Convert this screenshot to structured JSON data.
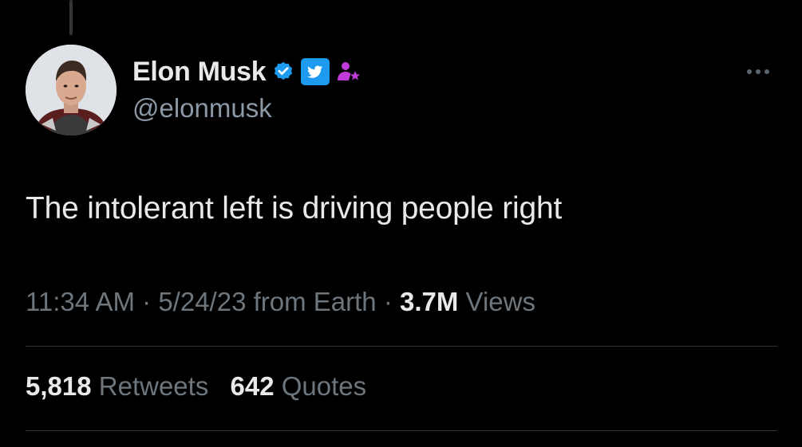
{
  "author": {
    "display_name": "Elon Musk",
    "handle": "@elonmusk",
    "badges": [
      "verified-badge-icon",
      "twitter-logo-badge-icon",
      "affiliate-person-star-icon"
    ]
  },
  "tweet": {
    "text": "The intolerant left is driving people right",
    "time": "11:34 AM",
    "separator": "·",
    "date_source": "5/24/23 from Earth",
    "views_count": "3.7M",
    "views_label": "Views"
  },
  "stats": {
    "retweets_count": "5,818",
    "retweets_label": "Retweets",
    "quotes_count": "642",
    "quotes_label": "Quotes"
  },
  "icons": {
    "more": "more-horizontal-icon"
  },
  "colors": {
    "background": "#000000",
    "primary_text": "#e7e9ea",
    "secondary_text": "#6e767d",
    "verified_blue": "#1d9bf0",
    "affiliate_purple": "#c13bd8",
    "divider": "#2f3336"
  }
}
